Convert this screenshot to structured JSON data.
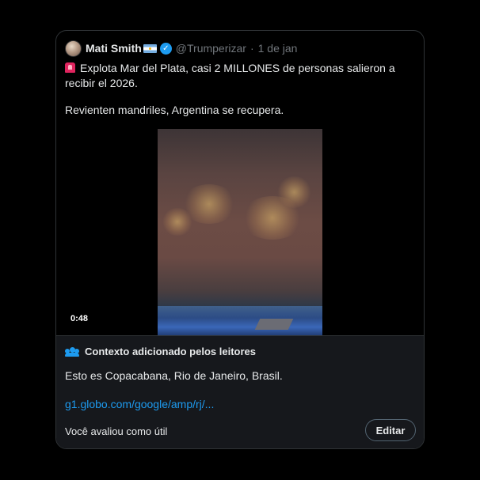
{
  "tweet": {
    "author_name": "Mati Smith",
    "handle": "@Trumperizar",
    "separator": "·",
    "date": "1 de jan",
    "text_line1": "Explota Mar del Plata, casi 2 MILLONES de personas salieron a recibir el 2026.",
    "text_line2": "Revienten mandriles, Argentina se recupera.",
    "icons": [
      "avatar",
      "argentina-flag-icon",
      "verified-badge-icon",
      "siren-icon"
    ]
  },
  "video": {
    "duration": "0:48"
  },
  "community_note": {
    "title": "Contexto adicionado pelos leitores",
    "body": "Esto es Copacabana, Rio de Janeiro, Brasil.",
    "link": "g1.globo.com/google/amp/rj/...",
    "rated_text": "Você avaliou como útil",
    "edit_label": "Editar",
    "icon": "people-icon"
  },
  "colors": {
    "accent": "#1d9bf0",
    "background": "#000000",
    "note_background": "#16181c",
    "text": "#e7e9ea",
    "muted": "#71767b"
  }
}
